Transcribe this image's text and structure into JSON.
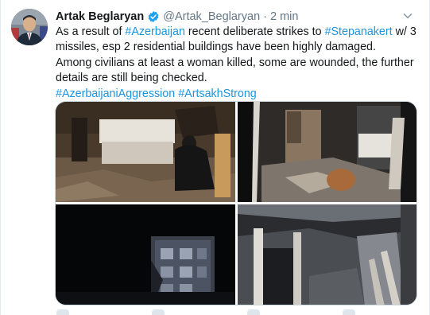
{
  "tweet": {
    "author_name": "Artak Beglaryan",
    "handle": "@Artak_Beglaryan",
    "separator": "·",
    "time": "2 min",
    "text_lines": [
      [
        {
          "t": "As a result of ",
          "tag": false
        },
        {
          "t": "#Azerbaijan",
          "tag": true
        },
        {
          "t": " recent deliberate strikes to ",
          "tag": false
        },
        {
          "t": "#Stepanakert",
          "tag": true
        },
        {
          "t": " w/ 3",
          "tag": false
        }
      ],
      [
        {
          "t": "missiles, esp 2 residential buildings have been highly damaged.",
          "tag": false
        }
      ],
      [
        {
          "t": "Among civilians at least a woman killed, some are wounded, the further",
          "tag": false
        }
      ],
      [
        {
          "t": "details are still being checked.",
          "tag": false
        }
      ],
      [
        {
          "t": "#AzerbaijaniAggression",
          "tag": true
        },
        {
          "t": " ",
          "tag": false
        },
        {
          "t": "#ArtsakhStrong",
          "tag": true
        }
      ]
    ]
  },
  "icons": {
    "avatar": "profile-photo",
    "verified": "verified-badge-icon",
    "menu": "chevron-down-icon"
  },
  "colors": {
    "text": "#14171a",
    "muted": "#657786",
    "link": "#1b95e0",
    "verified": "#1da1f2",
    "border": "#e6ecf0"
  }
}
